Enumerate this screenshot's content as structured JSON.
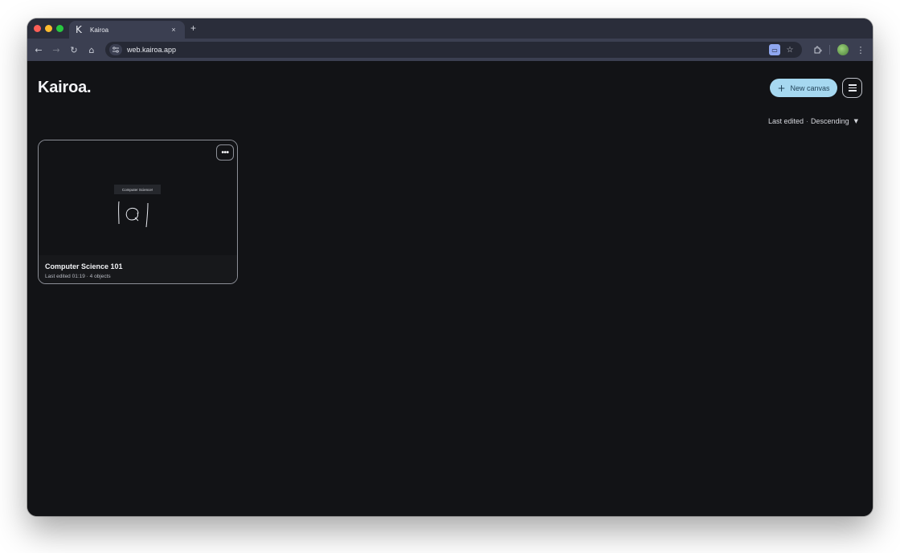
{
  "browser": {
    "tab": {
      "favicon": "K",
      "title": "Kairoa",
      "close": "×"
    },
    "new_tab": "+",
    "url": "web.kairoa.app",
    "nav": {
      "back": "←",
      "forward": "→",
      "reload": "↻",
      "home": "⌂"
    }
  },
  "app": {
    "logo": "Kairoa.",
    "new_canvas_label": "New canvas",
    "new_canvas_icon": "+",
    "sort": {
      "field": "Last edited",
      "separator": "·",
      "order": "Descending"
    },
    "cards": [
      {
        "title": "Computer Science 101",
        "meta": "Last edited 01:19 · 4 objects",
        "preview_label": "Computer Science!",
        "more": "•••"
      }
    ]
  },
  "colors": {
    "background": "#121316",
    "accent": "#a6d8f0",
    "tab_strip": "#2a2d3a",
    "toolbar": "#3b3f51"
  }
}
